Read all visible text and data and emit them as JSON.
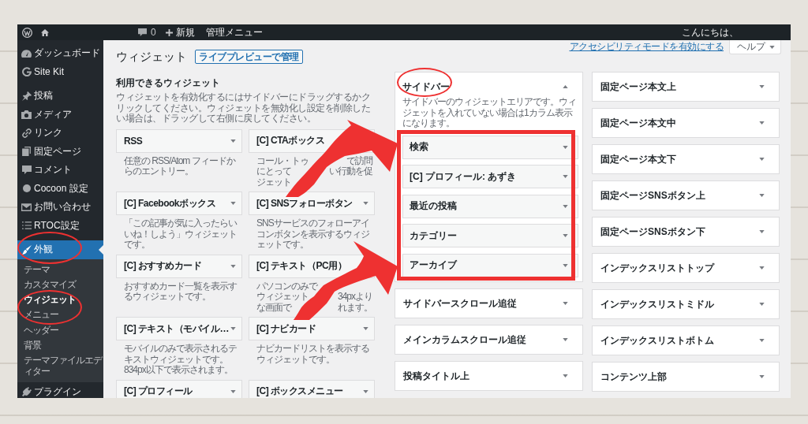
{
  "admin_bar": {
    "comments": "0",
    "new": "新規",
    "menu": "管理メニュー",
    "greeting": "こんにちは、"
  },
  "sidebar": {
    "groups": [
      {
        "items": [
          {
            "label": "ダッシュボード",
            "selected": false,
            "circled": false
          },
          {
            "label": "Site Kit",
            "selected": false,
            "circled": false
          }
        ]
      },
      {
        "items": [
          {
            "label": "投稿",
            "selected": false,
            "circled": false
          },
          {
            "label": "メディア",
            "selected": false,
            "circled": false
          },
          {
            "label": "リンク",
            "selected": false,
            "circled": false
          },
          {
            "label": "固定ページ",
            "selected": false,
            "circled": false
          },
          {
            "label": "コメント",
            "selected": false,
            "circled": false
          },
          {
            "label": "Cocoon 設定",
            "selected": false,
            "circled": false
          },
          {
            "label": "お問い合わせ",
            "selected": false,
            "circled": false
          },
          {
            "label": "RTOC設定",
            "selected": false,
            "circled": false
          }
        ]
      },
      {
        "items": [
          {
            "label": "外観",
            "selected": true,
            "circled": true,
            "children": [
              {
                "label": "テーマ",
                "selected": false,
                "circled": false
              },
              {
                "label": "カスタマイズ",
                "selected": false,
                "circled": false
              },
              {
                "label": "ウィジェット",
                "selected": true,
                "circled": true
              },
              {
                "label": "メニュー",
                "selected": false,
                "circled": false
              },
              {
                "label": "ヘッダー",
                "selected": false,
                "circled": false
              },
              {
                "label": "背景",
                "selected": false,
                "circled": false
              },
              {
                "label": "テーマファイルエディター",
                "selected": false,
                "circled": false
              }
            ]
          },
          {
            "label": "プラグイン",
            "selected": false,
            "circled": false
          }
        ]
      }
    ]
  },
  "header": {
    "title": "ウィジェット",
    "action": "ライブプレビューで管理",
    "accessibility_link": "アクセシビリティモードを有効にする",
    "help": "ヘルプ"
  },
  "available": {
    "title": "利用できるウィジェット",
    "description": "ウィジェットを有効化するにはサイドバーにドラッグするかクリックしてください。ウィジェットを無効化し設定を削除したい場合は、ドラッグして右側に戻してください。",
    "widgets": [
      {
        "title": "RSS",
        "caret": true,
        "description": "任意の RSS/Atom フィードからのエントリー。"
      },
      {
        "title": "[C] CTAボックス",
        "caret": false,
        "description_lines": [
          [
            "コール・トゥ",
            "で訪問"
          ],
          [
            "にとって",
            "い行動を促"
          ],
          [
            "ジェット"
          ]
        ]
      },
      {
        "title": "[C] Facebookボックス",
        "caret": true,
        "description": "「この記事が気に入ったらいいね！しよう」ウィジェットです。"
      },
      {
        "title": "[C] SNSフォローボタン",
        "caret": true,
        "description": "SNSサービスのフォローアイコンボタンを表示するウィジェットです。"
      },
      {
        "title": "[C] おすすめカード",
        "caret": true,
        "description": "おすすめカード一覧を表示するウィジェットです。"
      },
      {
        "title": "[C] テキスト（PC用）",
        "caret": false,
        "description_lines": [
          [
            "パソコンのみで"
          ],
          [
            "ウィジェット",
            "34pxより"
          ],
          [
            "な画面で",
            "れます。"
          ]
        ]
      },
      {
        "title": "[C] テキスト（モバイル…",
        "caret": true,
        "description": "モバイルのみで表示されるテキストウィジェットです。834px以下で表示されます。"
      },
      {
        "title": "[C] ナビカード",
        "caret": true,
        "description": "ナビカードリストを表示するウィジェットです。"
      },
      {
        "title": "[C] プロフィール",
        "caret": true
      },
      {
        "title": "[C] ボックスメニュー",
        "caret": true
      }
    ]
  },
  "widget_areas": {
    "columns": [
      {
        "areas": [
          {
            "title": "サイドバー",
            "expanded": true,
            "circled": true,
            "boxed": true,
            "description": "サイドバーのウィジェットエリアです。ウィジェットを入れていない場合は1カラム表示になります。",
            "widgets": [
              {
                "title": "検索"
              },
              {
                "title": "[C] プロフィール: あずき"
              },
              {
                "title": "最近の投稿"
              },
              {
                "title": "カテゴリー"
              },
              {
                "title": "アーカイブ"
              }
            ]
          },
          {
            "title": "サイドバースクロール追従",
            "expanded": false,
            "circled": false,
            "boxed": false
          },
          {
            "title": "メインカラムスクロール追従",
            "expanded": false,
            "circled": false,
            "boxed": false
          },
          {
            "title": "投稿タイトル上",
            "expanded": false,
            "circled": false,
            "boxed": false
          }
        ]
      },
      {
        "areas": [
          {
            "title": "固定ページ本文上",
            "expanded": false,
            "circled": false,
            "boxed": false
          },
          {
            "title": "固定ページ本文中",
            "expanded": false,
            "circled": false,
            "boxed": false
          },
          {
            "title": "固定ページ本文下",
            "expanded": false,
            "circled": false,
            "boxed": false
          },
          {
            "title": "固定ページSNSボタン上",
            "expanded": false,
            "circled": false,
            "boxed": false
          },
          {
            "title": "固定ページSNSボタン下",
            "expanded": false,
            "circled": false,
            "boxed": false
          },
          {
            "title": "インデックスリストトップ",
            "expanded": false,
            "circled": false,
            "boxed": false
          },
          {
            "title": "インデックスリストミドル",
            "expanded": false,
            "circled": false,
            "boxed": false
          },
          {
            "title": "インデックスリストボトム",
            "expanded": false,
            "circled": false,
            "boxed": false
          },
          {
            "title": "コンテンツ上部",
            "expanded": false,
            "circled": false,
            "boxed": false
          }
        ]
      }
    ]
  },
  "annotations": [
    {
      "kind": "arrow"
    },
    {
      "kind": "arrow"
    }
  ]
}
